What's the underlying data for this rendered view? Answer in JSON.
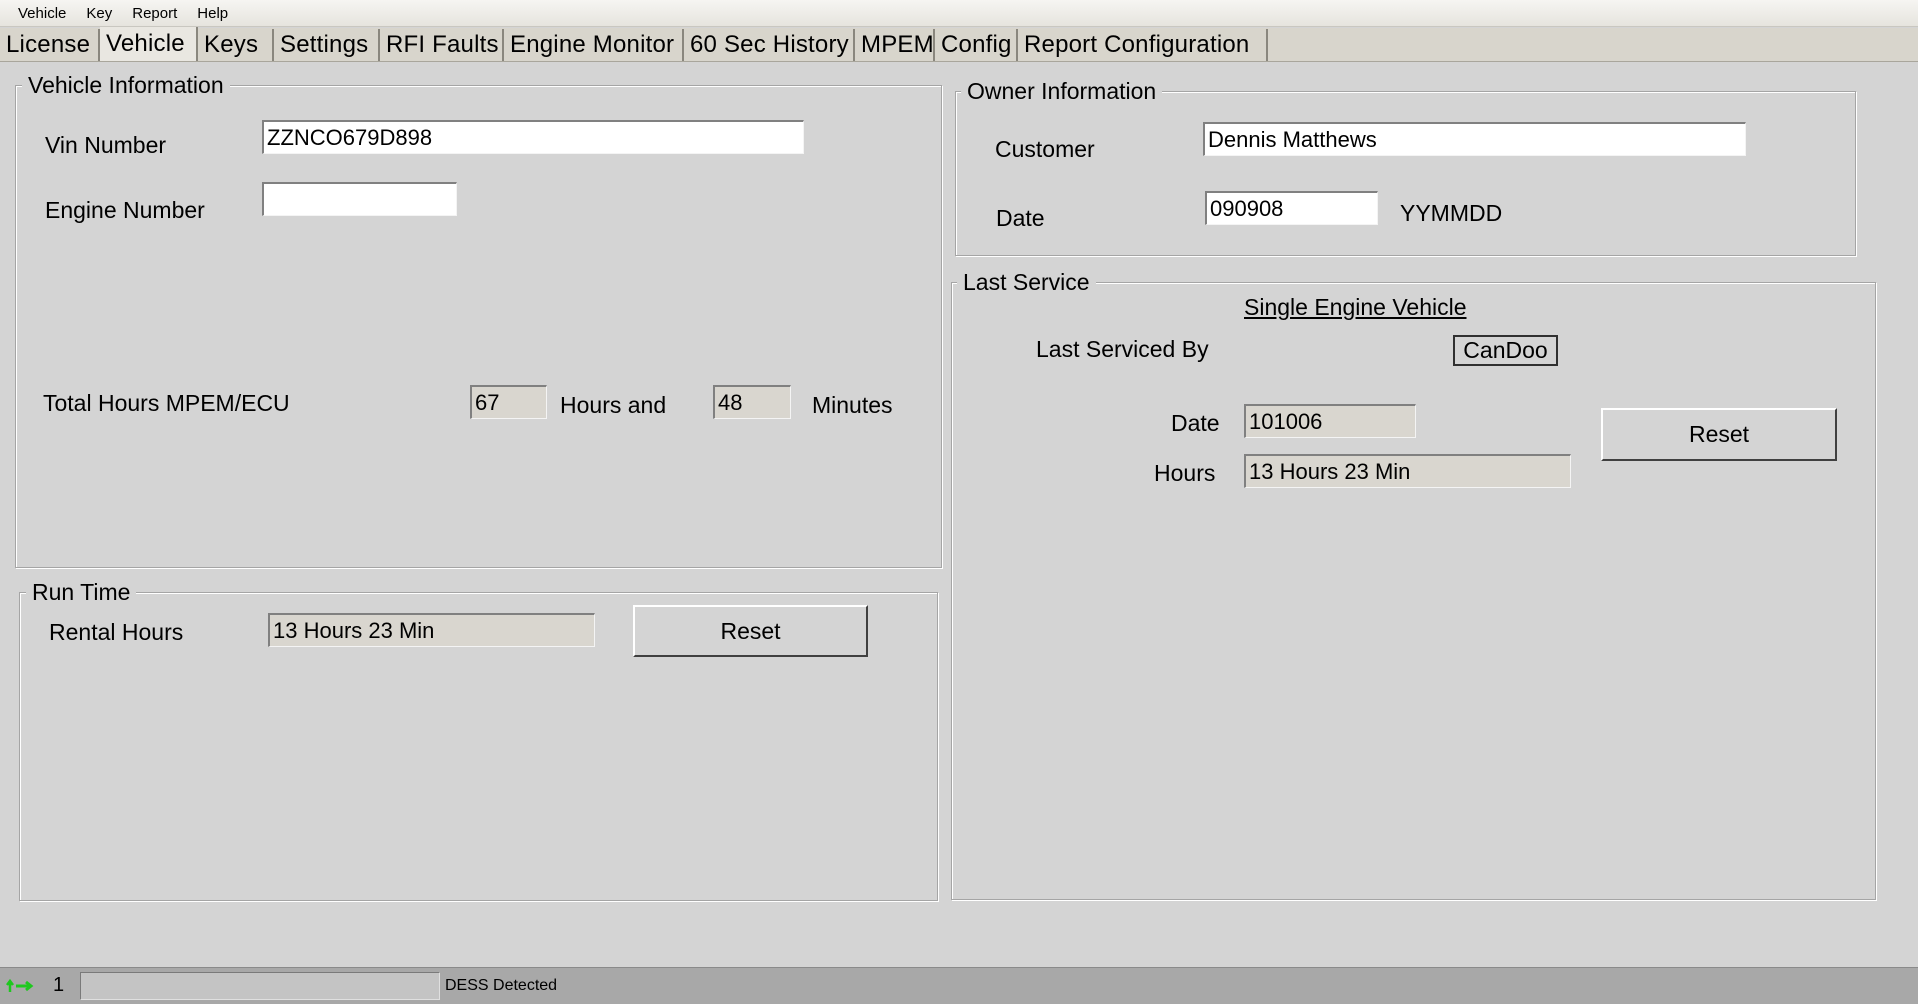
{
  "menu": [
    "Vehicle",
    "Key",
    "Report",
    "Help"
  ],
  "tabs": [
    "License",
    "Vehicle",
    "Keys",
    "Settings",
    "RFI Faults",
    "Engine Monitor",
    "60 Sec History",
    "MPEM",
    "Config",
    "Report Configuration"
  ],
  "active_tab": "Vehicle",
  "vehicle_info": {
    "title": "Vehicle Information",
    "vin_label": "Vin Number",
    "vin_value": "ZZNCO679D898",
    "engine_label": "Engine Number",
    "engine_value": "",
    "total_hours_label": "Total Hours MPEM/ECU",
    "hours_value": "67",
    "hours_and_label": "Hours and",
    "minutes_value": "48",
    "minutes_label": "Minutes"
  },
  "run_time": {
    "title": "Run Time",
    "rental_label": "Rental Hours",
    "rental_value": "13 Hours  23 Min",
    "reset_label": "Reset"
  },
  "owner_info": {
    "title": "Owner Information",
    "customer_label": "Customer",
    "customer_value": "Dennis Matthews",
    "date_label": "Date",
    "date_value": "090908",
    "date_format": "YYMMDD"
  },
  "last_service": {
    "title": "Last Service",
    "subtitle": "Single Engine Vehicle",
    "serviced_by_label": "Last Serviced By",
    "serviced_by_value": "CanDoo",
    "date_label": "Date",
    "date_value": "101006",
    "hours_label": "Hours",
    "hours_value": "13 Hours  23 Min",
    "reset_label": "Reset"
  },
  "status": {
    "icon": "connection-arrows-icon",
    "count": "1",
    "message": "DESS Detected",
    "icon_color": "#1ec81e"
  }
}
